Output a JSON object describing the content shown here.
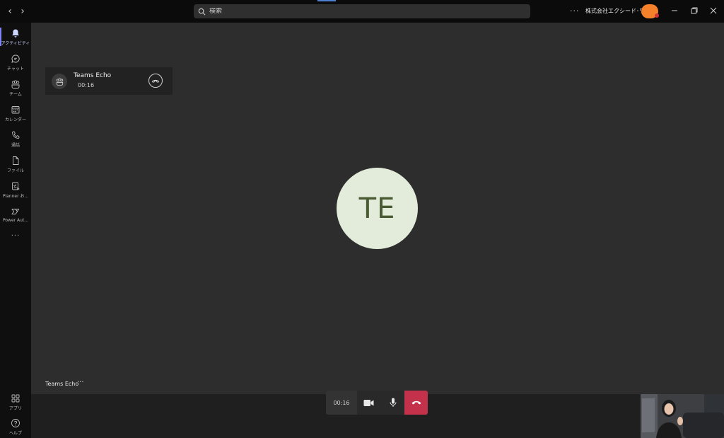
{
  "titlebar": {
    "nav_back": "‹",
    "nav_forward": "›",
    "search_placeholder": "検索",
    "more": "···",
    "org_name": "株式会社エクシード･ワン",
    "accent_color": "#4f7fd0",
    "avatar_color": "#f5812a"
  },
  "rail": {
    "items": [
      {
        "label": "アクティビティ",
        "icon": "bell-icon"
      },
      {
        "label": "チャット",
        "icon": "chat-icon"
      },
      {
        "label": "チーム",
        "icon": "teams-icon"
      },
      {
        "label": "カレンダー",
        "icon": "calendar-icon"
      },
      {
        "label": "通話",
        "icon": "phone-icon"
      },
      {
        "label": "ファイル",
        "icon": "file-icon"
      },
      {
        "label": "Planner お...",
        "icon": "planner-icon"
      },
      {
        "label": "Power Aut...",
        "icon": "power-automate-icon"
      }
    ],
    "more": "···",
    "bottom_items": [
      {
        "label": "アプリ",
        "icon": "apps-icon"
      },
      {
        "label": "ヘルプ",
        "icon": "help-icon"
      }
    ],
    "active_color": "#7f85f5"
  },
  "call_card": {
    "name": "Teams Echo",
    "time": "00:16"
  },
  "stage": {
    "avatar_initials": "TE",
    "participant_name": "Teams Echo",
    "participant_more": "···",
    "avatar_bg": "#e3ecda",
    "avatar_fg": "#4a5a33"
  },
  "controls": {
    "time": "00:16",
    "hangup_color": "#c4314b"
  }
}
